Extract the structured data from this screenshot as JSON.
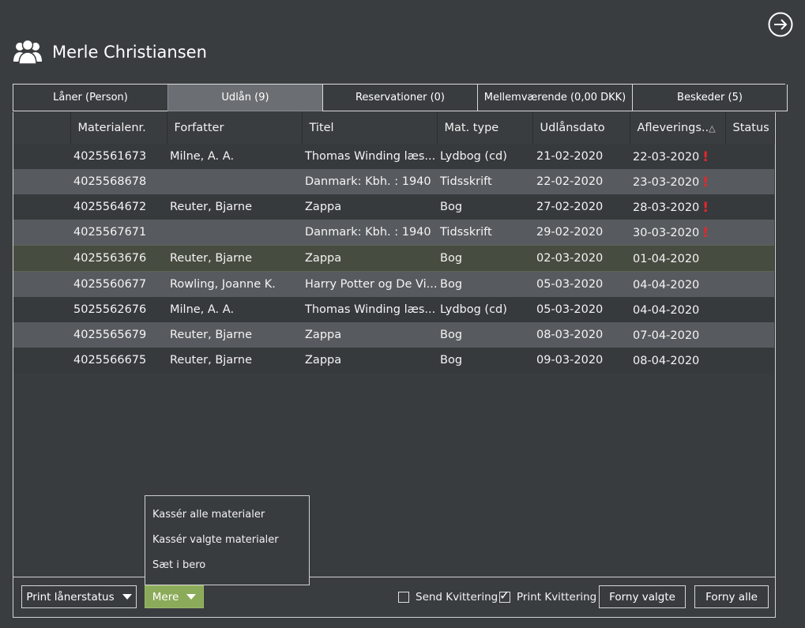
{
  "header": {
    "user_name": "Merle Christiansen",
    "user_icon": "users-icon",
    "exit_icon": "arrow-right-circle-icon"
  },
  "tabs": [
    {
      "label": "Låner (Person)",
      "active": false
    },
    {
      "label": "Udlån (9)",
      "active": true
    },
    {
      "label": "Reservationer (0)",
      "active": false
    },
    {
      "label": "Mellemværende (0,00 DKK)",
      "active": false
    },
    {
      "label": "Beskeder (5)",
      "active": false
    }
  ],
  "table": {
    "columns": [
      "",
      "Materialenr.",
      "Forfatter",
      "Titel",
      "Mat. type",
      "Udlånsdato",
      "Afleverings..",
      "Status"
    ],
    "sort_indicator": "△",
    "rows": [
      {
        "matnr": "4025561673",
        "author": "Milne, A. A.",
        "title": "Thomas Winding læs...",
        "type": "Lydbog (cd)",
        "loan_date": "21-02-2020",
        "due_date": "22-03-2020",
        "overdue": "!",
        "status": ""
      },
      {
        "matnr": "4025568678",
        "author": "",
        "title": "Danmark: Kbh. : 1940",
        "type": "Tidsskrift",
        "loan_date": "22-02-2020",
        "due_date": "23-03-2020",
        "overdue": "!",
        "status": ""
      },
      {
        "matnr": "4025564672",
        "author": "Reuter, Bjarne",
        "title": "Zappa",
        "type": "Bog",
        "loan_date": "27-02-2020",
        "due_date": "28-03-2020",
        "overdue": "!",
        "status": ""
      },
      {
        "matnr": "4025567671",
        "author": "",
        "title": "Danmark: Kbh. : 1940",
        "type": "Tidsskrift",
        "loan_date": "29-02-2020",
        "due_date": "30-03-2020",
        "overdue": "!",
        "status": ""
      },
      {
        "matnr": "4025563676",
        "author": "Reuter, Bjarne",
        "title": "Zappa",
        "type": "Bog",
        "loan_date": "02-03-2020",
        "due_date": "01-04-2020",
        "overdue": "",
        "status": ""
      },
      {
        "matnr": "4025560677",
        "author": "Rowling, Joanne K.",
        "title": "Harry Potter og De Vi...",
        "type": "Bog",
        "loan_date": "05-03-2020",
        "due_date": "04-04-2020",
        "overdue": "",
        "status": ""
      },
      {
        "matnr": "5025562676",
        "author": "Milne, A. A.",
        "title": "Thomas Winding læs...",
        "type": "Lydbog (cd)",
        "loan_date": "05-03-2020",
        "due_date": "04-04-2020",
        "overdue": "",
        "status": ""
      },
      {
        "matnr": "4025565679",
        "author": "Reuter, Bjarne",
        "title": "Zappa",
        "type": "Bog",
        "loan_date": "08-03-2020",
        "due_date": "07-04-2020",
        "overdue": "",
        "status": ""
      },
      {
        "matnr": "4025566675",
        "author": "Reuter, Bjarne",
        "title": "Zappa",
        "type": "Bog",
        "loan_date": "09-03-2020",
        "due_date": "08-04-2020",
        "overdue": "",
        "status": ""
      }
    ]
  },
  "dropdown": {
    "items": [
      "Kassér alle materialer",
      "Kassér valgte materialer",
      "Sæt i bero"
    ]
  },
  "bottom": {
    "print_status_label": "Print lånerstatus",
    "more_label": "Mere",
    "send_receipt_label": "Send Kvittering",
    "send_receipt_checked": false,
    "print_receipt_label": "Print Kvittering",
    "print_receipt_checked": true,
    "checkmark": "✓",
    "renew_selected_label": "Forny valgte",
    "renew_all_label": "Forny alle"
  },
  "colors": {
    "background": "#3a3d40",
    "accent_button": "#8cab5a",
    "overdue": "#e8262b",
    "selected_row": "#474c40"
  }
}
